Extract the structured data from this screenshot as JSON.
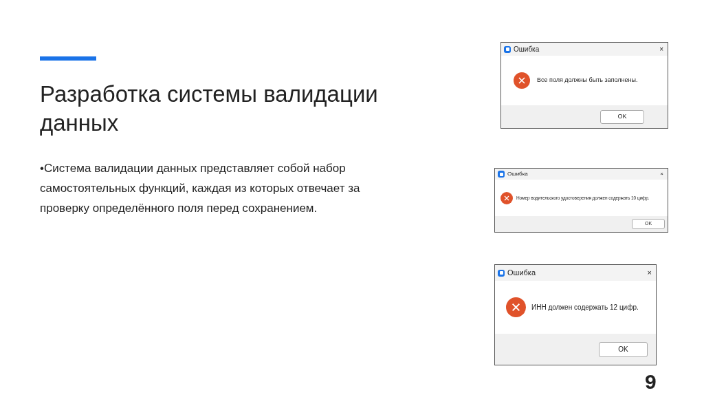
{
  "slide": {
    "title": "Разработка системы валидации данных",
    "body": "•Система валидации данных представляет собой набор самостоятельных функций, каждая из которых отвечает за проверку определённого поля перед сохранением.",
    "page_number": "9"
  },
  "dialogs": [
    {
      "title": "Ошибка",
      "close": "×",
      "message": "Все поля должны быть заполнены.",
      "button": "OK"
    },
    {
      "title": "Ошибка",
      "close": "×",
      "message": "Номер водительского удостоверения должен содержать 10 цифр.",
      "button": "OK"
    },
    {
      "title": "Ошибка",
      "close": "×",
      "message": "ИНН должен содержать 12 цифр.",
      "button": "OK"
    }
  ]
}
